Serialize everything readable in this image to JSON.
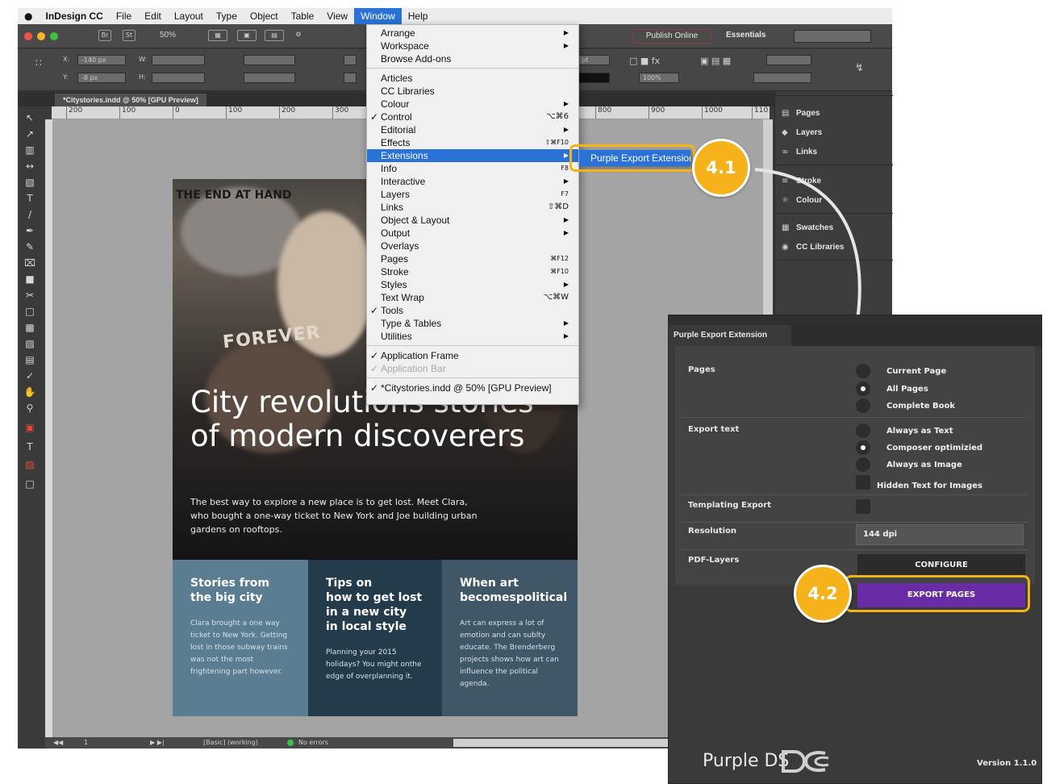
{
  "menubar": {
    "items": [
      "InDesign CC",
      "File",
      "Edit",
      "Layout",
      "Type",
      "Object",
      "Table",
      "View",
      "Window",
      "Help"
    ]
  },
  "app": {
    "zoom": "50%",
    "publish_online": "Publish Online",
    "workspace": "Essentials",
    "control": {
      "x_label": "X:",
      "x_value": "-140 px",
      "y_label": "Y:",
      "y_value": "-8 px",
      "w_label": "W:",
      "h_label": "H:",
      "stroke_unit": "pt",
      "zoom_pct": "100%"
    },
    "doc_tab": "*Citystories.indd @ 50% [GPU Preview]",
    "ruler_ticks": [
      "200",
      "100",
      "0",
      "100",
      "200",
      "300",
      "800",
      "900",
      "1000",
      "110"
    ],
    "status": {
      "page": "1",
      "style": "[Basic] (working)",
      "errors": "No errors"
    }
  },
  "right_panel": {
    "items": [
      {
        "icon": "pages-icon",
        "label": "Pages"
      },
      {
        "icon": "layers-icon",
        "label": "Layers"
      },
      {
        "icon": "links-icon",
        "label": "Links"
      },
      {
        "icon": "stroke-icon",
        "label": "Stroke"
      },
      {
        "icon": "colour-icon",
        "label": "Colour"
      },
      {
        "icon": "swatches-icon",
        "label": "Swatches"
      },
      {
        "icon": "cc-libraries-icon",
        "label": "CC Libraries"
      }
    ]
  },
  "window_menu": {
    "rows": [
      {
        "label": "Arrange",
        "submenu": true
      },
      {
        "label": "Workspace",
        "submenu": true
      },
      {
        "label": "Browse Add-ons"
      },
      {
        "separator": true
      },
      {
        "label": "Articles"
      },
      {
        "label": "CC Libraries"
      },
      {
        "label": "Colour",
        "submenu": true
      },
      {
        "label": "Control",
        "checked": true,
        "shortcut": "⌥⌘6"
      },
      {
        "label": "Editorial",
        "submenu": true
      },
      {
        "label": "Effects",
        "shortcut": "⇧⌘F10"
      },
      {
        "label": "Extensions",
        "submenu": true,
        "highlighted": true
      },
      {
        "label": "Info",
        "shortcut": "F8"
      },
      {
        "label": "Interactive",
        "submenu": true
      },
      {
        "label": "Layers",
        "shortcut": "F7"
      },
      {
        "label": "Links",
        "shortcut": "⇧⌘D"
      },
      {
        "label": "Object & Layout",
        "submenu": true
      },
      {
        "label": "Output",
        "submenu": true
      },
      {
        "label": "Overlays"
      },
      {
        "label": "Pages",
        "shortcut": "⌘F12"
      },
      {
        "label": "Stroke",
        "shortcut": "⌘F10"
      },
      {
        "label": "Styles",
        "submenu": true
      },
      {
        "label": "Text Wrap",
        "shortcut": "⌥⌘W"
      },
      {
        "label": "Tools",
        "checked": true
      },
      {
        "label": "Type & Tables",
        "submenu": true
      },
      {
        "label": "Utilities",
        "submenu": true
      },
      {
        "separator": true
      },
      {
        "label": "Application Frame",
        "checked": true
      },
      {
        "label": "Application Bar",
        "checked": true,
        "disabled": true
      },
      {
        "separator": true
      },
      {
        "label": "*Citystories.indd @ 50% [GPU Preview]",
        "checked": true
      }
    ],
    "submenu_item": "Purple Export Extension"
  },
  "badges": {
    "step1": "4.1",
    "step2": "4.2"
  },
  "page": {
    "photo_text": [
      "FOREVER",
      "THE END AT HAND"
    ],
    "title": "City revolutions stories of modern discoverers",
    "subtitle": "The best way to explore a new place is to get lost. Meet Clara, who bought a one-way ticket to New York and Joe building urban gardens on rooftops.",
    "columns": [
      {
        "heading": "Stories from\nthe big city",
        "body": "Clara brought a one way ticket to New York. Getting lost in those subway trains was not the most frightening part however.",
        "bg": "#5a7d92"
      },
      {
        "heading": "Tips on\nhow to get lost\nin a new city\nin local style",
        "body": "Planning your 2015 holidays? You might onthe edge of overplanning it.",
        "bg": "#233b4a"
      },
      {
        "heading": "When art\nbecomespolitical",
        "body": "Art can express a lot of emotion and can sublty educate. The Brenderberg projects shows how art can influence the political agenda.",
        "bg": "#3f5766"
      }
    ]
  },
  "extension": {
    "tab": "Purple Export Extension",
    "pages_label": "Pages",
    "pages_options": [
      {
        "label": "Current Page",
        "selected": false
      },
      {
        "label": "All Pages",
        "selected": true
      },
      {
        "label": "Complete Book",
        "selected": false
      }
    ],
    "export_text_label": "Export text",
    "export_text_options": [
      {
        "label": "Always as Text",
        "selected": false
      },
      {
        "label": "Composer optimizied",
        "selected": true
      },
      {
        "label": "Always as Image",
        "selected": false
      }
    ],
    "hidden_text": "Hidden Text for Images",
    "templating_label": "Templating Export",
    "resolution_label": "Resolution",
    "resolution_value": "144 dpi",
    "pdf_layers_label": "PDF-Layers",
    "configure": "CONFIGURE",
    "export_pages": "EXPORT PAGES",
    "brand": "Purple DS",
    "version": "Version 1.1.0"
  },
  "colors": {
    "accent": "#6a2ba6",
    "highlight": "#f2b416",
    "menu_highlight": "#2b72d7"
  }
}
